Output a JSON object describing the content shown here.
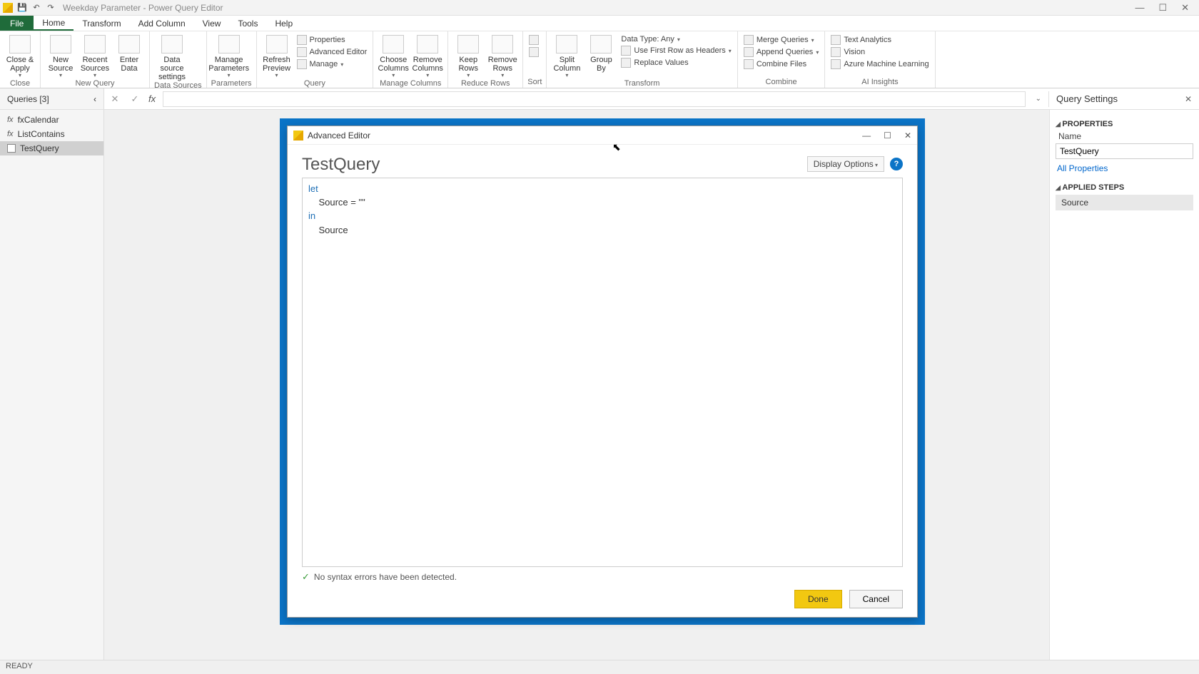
{
  "titlebar": {
    "title": "Weekday Parameter - Power Query Editor"
  },
  "menu": {
    "file": "File",
    "tabs": [
      "Home",
      "Transform",
      "Add Column",
      "View",
      "Tools",
      "Help"
    ]
  },
  "ribbon": {
    "close": {
      "label": "Close &\nApply",
      "group": "Close"
    },
    "newquery": {
      "new_source": "New\nSource",
      "recent_sources": "Recent\nSources",
      "enter_data": "Enter\nData",
      "group": "New Query"
    },
    "datasources": {
      "btn": "Data source\nsettings",
      "group": "Data Sources"
    },
    "parameters": {
      "btn": "Manage\nParameters",
      "group": "Parameters"
    },
    "query": {
      "refresh": "Refresh\nPreview",
      "properties": "Properties",
      "advanced": "Advanced Editor",
      "manage": "Manage",
      "group": "Query"
    },
    "manage_cols": {
      "choose": "Choose\nColumns",
      "remove": "Remove\nColumns",
      "group": "Manage Columns"
    },
    "reduce_rows": {
      "keep": "Keep\nRows",
      "remove": "Remove\nRows",
      "group": "Reduce Rows"
    },
    "sort": {
      "group": "Sort"
    },
    "transform": {
      "split": "Split\nColumn",
      "groupby": "Group\nBy",
      "datatype": "Data Type: Any",
      "firstrow": "Use First Row as Headers",
      "replace": "Replace Values",
      "group": "Transform"
    },
    "combine": {
      "merge": "Merge Queries",
      "append": "Append Queries",
      "combine_files": "Combine Files",
      "group": "Combine"
    },
    "ai": {
      "text": "Text Analytics",
      "vision": "Vision",
      "azure": "Azure Machine Learning",
      "group": "AI Insights"
    }
  },
  "queries": {
    "header": "Queries [3]",
    "items": [
      {
        "name": "fxCalendar",
        "type": "fx"
      },
      {
        "name": "ListContains",
        "type": "fx"
      },
      {
        "name": "TestQuery",
        "type": "tbl"
      }
    ]
  },
  "settings": {
    "header": "Query Settings",
    "properties": "PROPERTIES",
    "name_label": "Name",
    "name_value": "TestQuery",
    "all_properties": "All Properties",
    "applied_steps": "APPLIED STEPS",
    "step1": "Source"
  },
  "dialog": {
    "title": "Advanced Editor",
    "heading": "TestQuery",
    "display_options": "Display Options",
    "code_kw1": "let",
    "code_line2": "    Source = \"\"",
    "code_kw2": "in",
    "code_line4": "    Source",
    "status": "No syntax errors have been detected.",
    "done": "Done",
    "cancel": "Cancel"
  },
  "statusbar": "READY"
}
